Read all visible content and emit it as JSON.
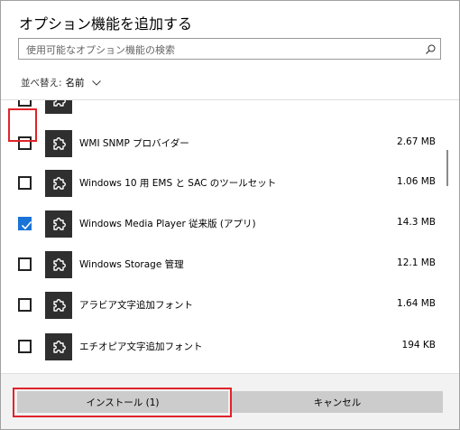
{
  "dialog": {
    "title": "オプション機能を追加する"
  },
  "search": {
    "placeholder": "使用可能なオプション機能の検索",
    "icon": "search-icon"
  },
  "sort": {
    "label": "並べ替え:",
    "value": "名前"
  },
  "features": [
    {
      "name": "",
      "size": "",
      "checked": false,
      "partial": "top"
    },
    {
      "name": "WMI SNMP プロバイダー",
      "size": "2.67 MB",
      "checked": false
    },
    {
      "name": "Windows 10 用 EMS と SAC のツールセット",
      "size": "1.06 MB",
      "checked": false
    },
    {
      "name": "Windows Media Player 従来版 (アプリ)",
      "size": "14.3 MB",
      "checked": true
    },
    {
      "name": "Windows Storage 管理",
      "size": "12.1 MB",
      "checked": false
    },
    {
      "name": "アラビア文字追加フォント",
      "size": "1.64 MB",
      "checked": false
    },
    {
      "name": "エチオピア文字追加フォント",
      "size": "194 KB",
      "checked": false
    },
    {
      "name": "",
      "size": "",
      "checked": false,
      "partial": "bottom"
    }
  ],
  "buttons": {
    "install_label": "インストール (1)",
    "cancel_label": "キャンセル"
  },
  "colors": {
    "checked": "#1a73d6",
    "highlight": "#e0242a",
    "button": "#cccccc",
    "tile": "#2f2f2f"
  }
}
